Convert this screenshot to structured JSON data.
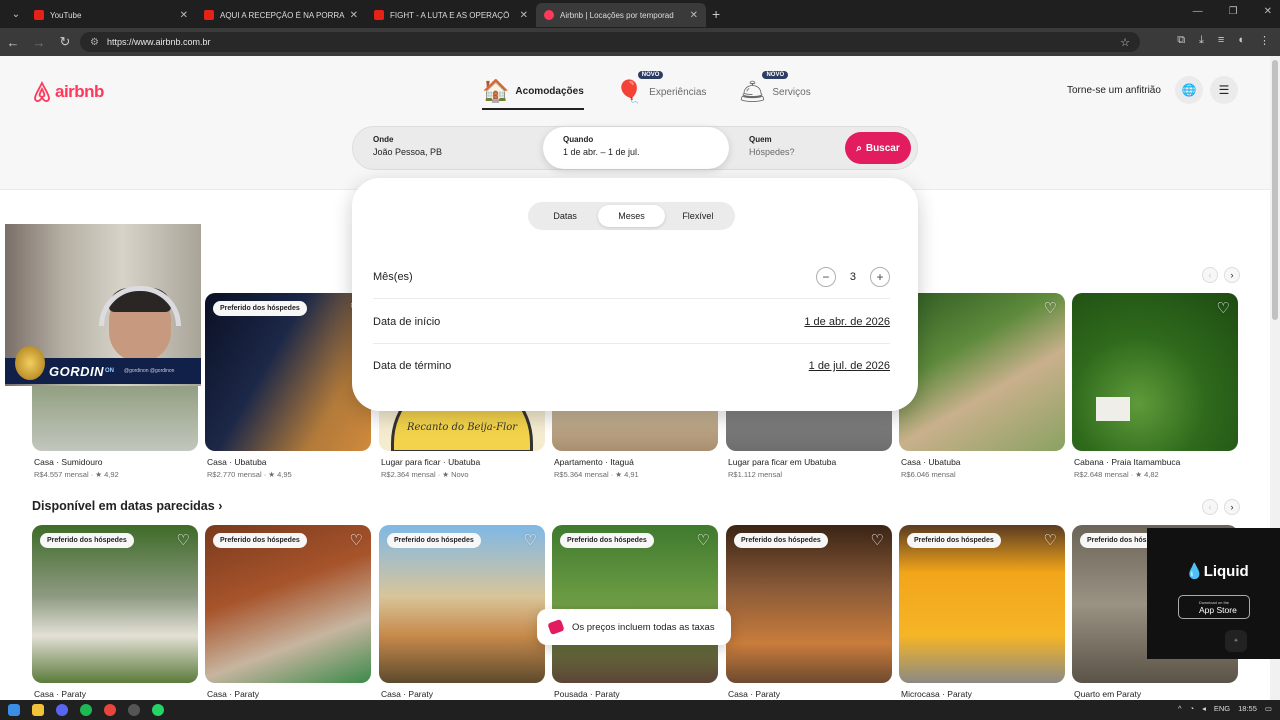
{
  "browser": {
    "tabs": [
      {
        "title": "YouTube",
        "active": false
      },
      {
        "title": "AQUI A RECEPÇÃO É NA PORRA",
        "active": false
      },
      {
        "title": "FIGHT - A LUTA E AS OPERAÇÕ",
        "active": false
      },
      {
        "title": "Airbnb | Locações por temporad",
        "active": true
      }
    ],
    "url": "https://www.airbnb.com.br"
  },
  "header": {
    "logo": "airbnb",
    "nav": [
      {
        "label": "Acomodações",
        "icon": "house-icon",
        "badge": ""
      },
      {
        "label": "Experiências",
        "icon": "balloon-icon",
        "badge": "NOVO"
      },
      {
        "label": "Serviços",
        "icon": "bell-icon",
        "badge": "NOVO"
      }
    ],
    "host": "Torne-se um anfitrião"
  },
  "search": {
    "where_label": "Onde",
    "where_value": "João Pessoa, PB",
    "when_label": "Quando",
    "when_value": "1 de abr. – 1 de jul.",
    "who_label": "Quem",
    "who_placeholder": "Hóspedes?",
    "button": "Buscar"
  },
  "date_panel": {
    "tabs": [
      "Datas",
      "Meses",
      "Flexível"
    ],
    "selected_tab": "Meses",
    "months_label": "Mês(es)",
    "months_value": "3",
    "start_label": "Data de início",
    "start_value": "1 de abr. de 2026",
    "end_label": "Data de término",
    "end_value": "1 de jul. de 2026"
  },
  "row1": [
    {
      "title": "Casa · Sumidouro",
      "sub": "R$4.557 mensal · ★ 4,92",
      "badge": ""
    },
    {
      "title": "Casa · Ubatuba",
      "sub": "R$2.770 mensal · ★ 4,95",
      "badge": "Preferido dos hóspedes"
    },
    {
      "title": "Lugar para ficar · Ubatuba",
      "sub": "R$2.364 mensal · ★ Novo",
      "badge": "",
      "caption": "Recanto do Beija-Flor"
    },
    {
      "title": "Apartamento · Itaguá",
      "sub": "R$5.364 mensal · ★ 4,91",
      "badge": ""
    },
    {
      "title": "Lugar para ficar em Ubatuba",
      "sub": "R$1.112 mensal",
      "badge": ""
    },
    {
      "title": "Casa · Ubatuba",
      "sub": "R$6.046 mensal",
      "badge": ""
    },
    {
      "title": "Cabana · Praia Itamambuca",
      "sub": "R$2.648 mensal · ★ 4,82",
      "badge": ""
    }
  ],
  "section2": {
    "title": "Disponível em datas parecidas ›"
  },
  "row2": [
    {
      "title": "Casa · Paraty",
      "badge": "Preferido dos hóspedes"
    },
    {
      "title": "Casa · Paraty",
      "badge": "Preferido dos hóspedes"
    },
    {
      "title": "Casa · Paraty",
      "badge": "Preferido dos hóspedes"
    },
    {
      "title": "Pousada · Paraty",
      "badge": "Preferido dos hóspedes"
    },
    {
      "title": "Casa · Paraty",
      "badge": "Preferido dos hóspedes"
    },
    {
      "title": "Microcasa · Paraty",
      "badge": "Preferido dos hóspedes"
    },
    {
      "title": "Quarto em Paraty",
      "badge": "Preferido dos hóspedes"
    }
  ],
  "toast": "Os preços incluem todas as taxas",
  "stream_overlay": {
    "name": "GORDIN",
    "tag": "ON",
    "handles": "@gordinon  @gordinon"
  },
  "ad": {
    "brand": "Liquid",
    "store_small": "Download on the",
    "store": "App Store"
  },
  "taskbar": {
    "lang": "ENG",
    "time": "18:55"
  },
  "colors": {
    "brand": "#ff385c",
    "search_button": "#e31c5f"
  }
}
